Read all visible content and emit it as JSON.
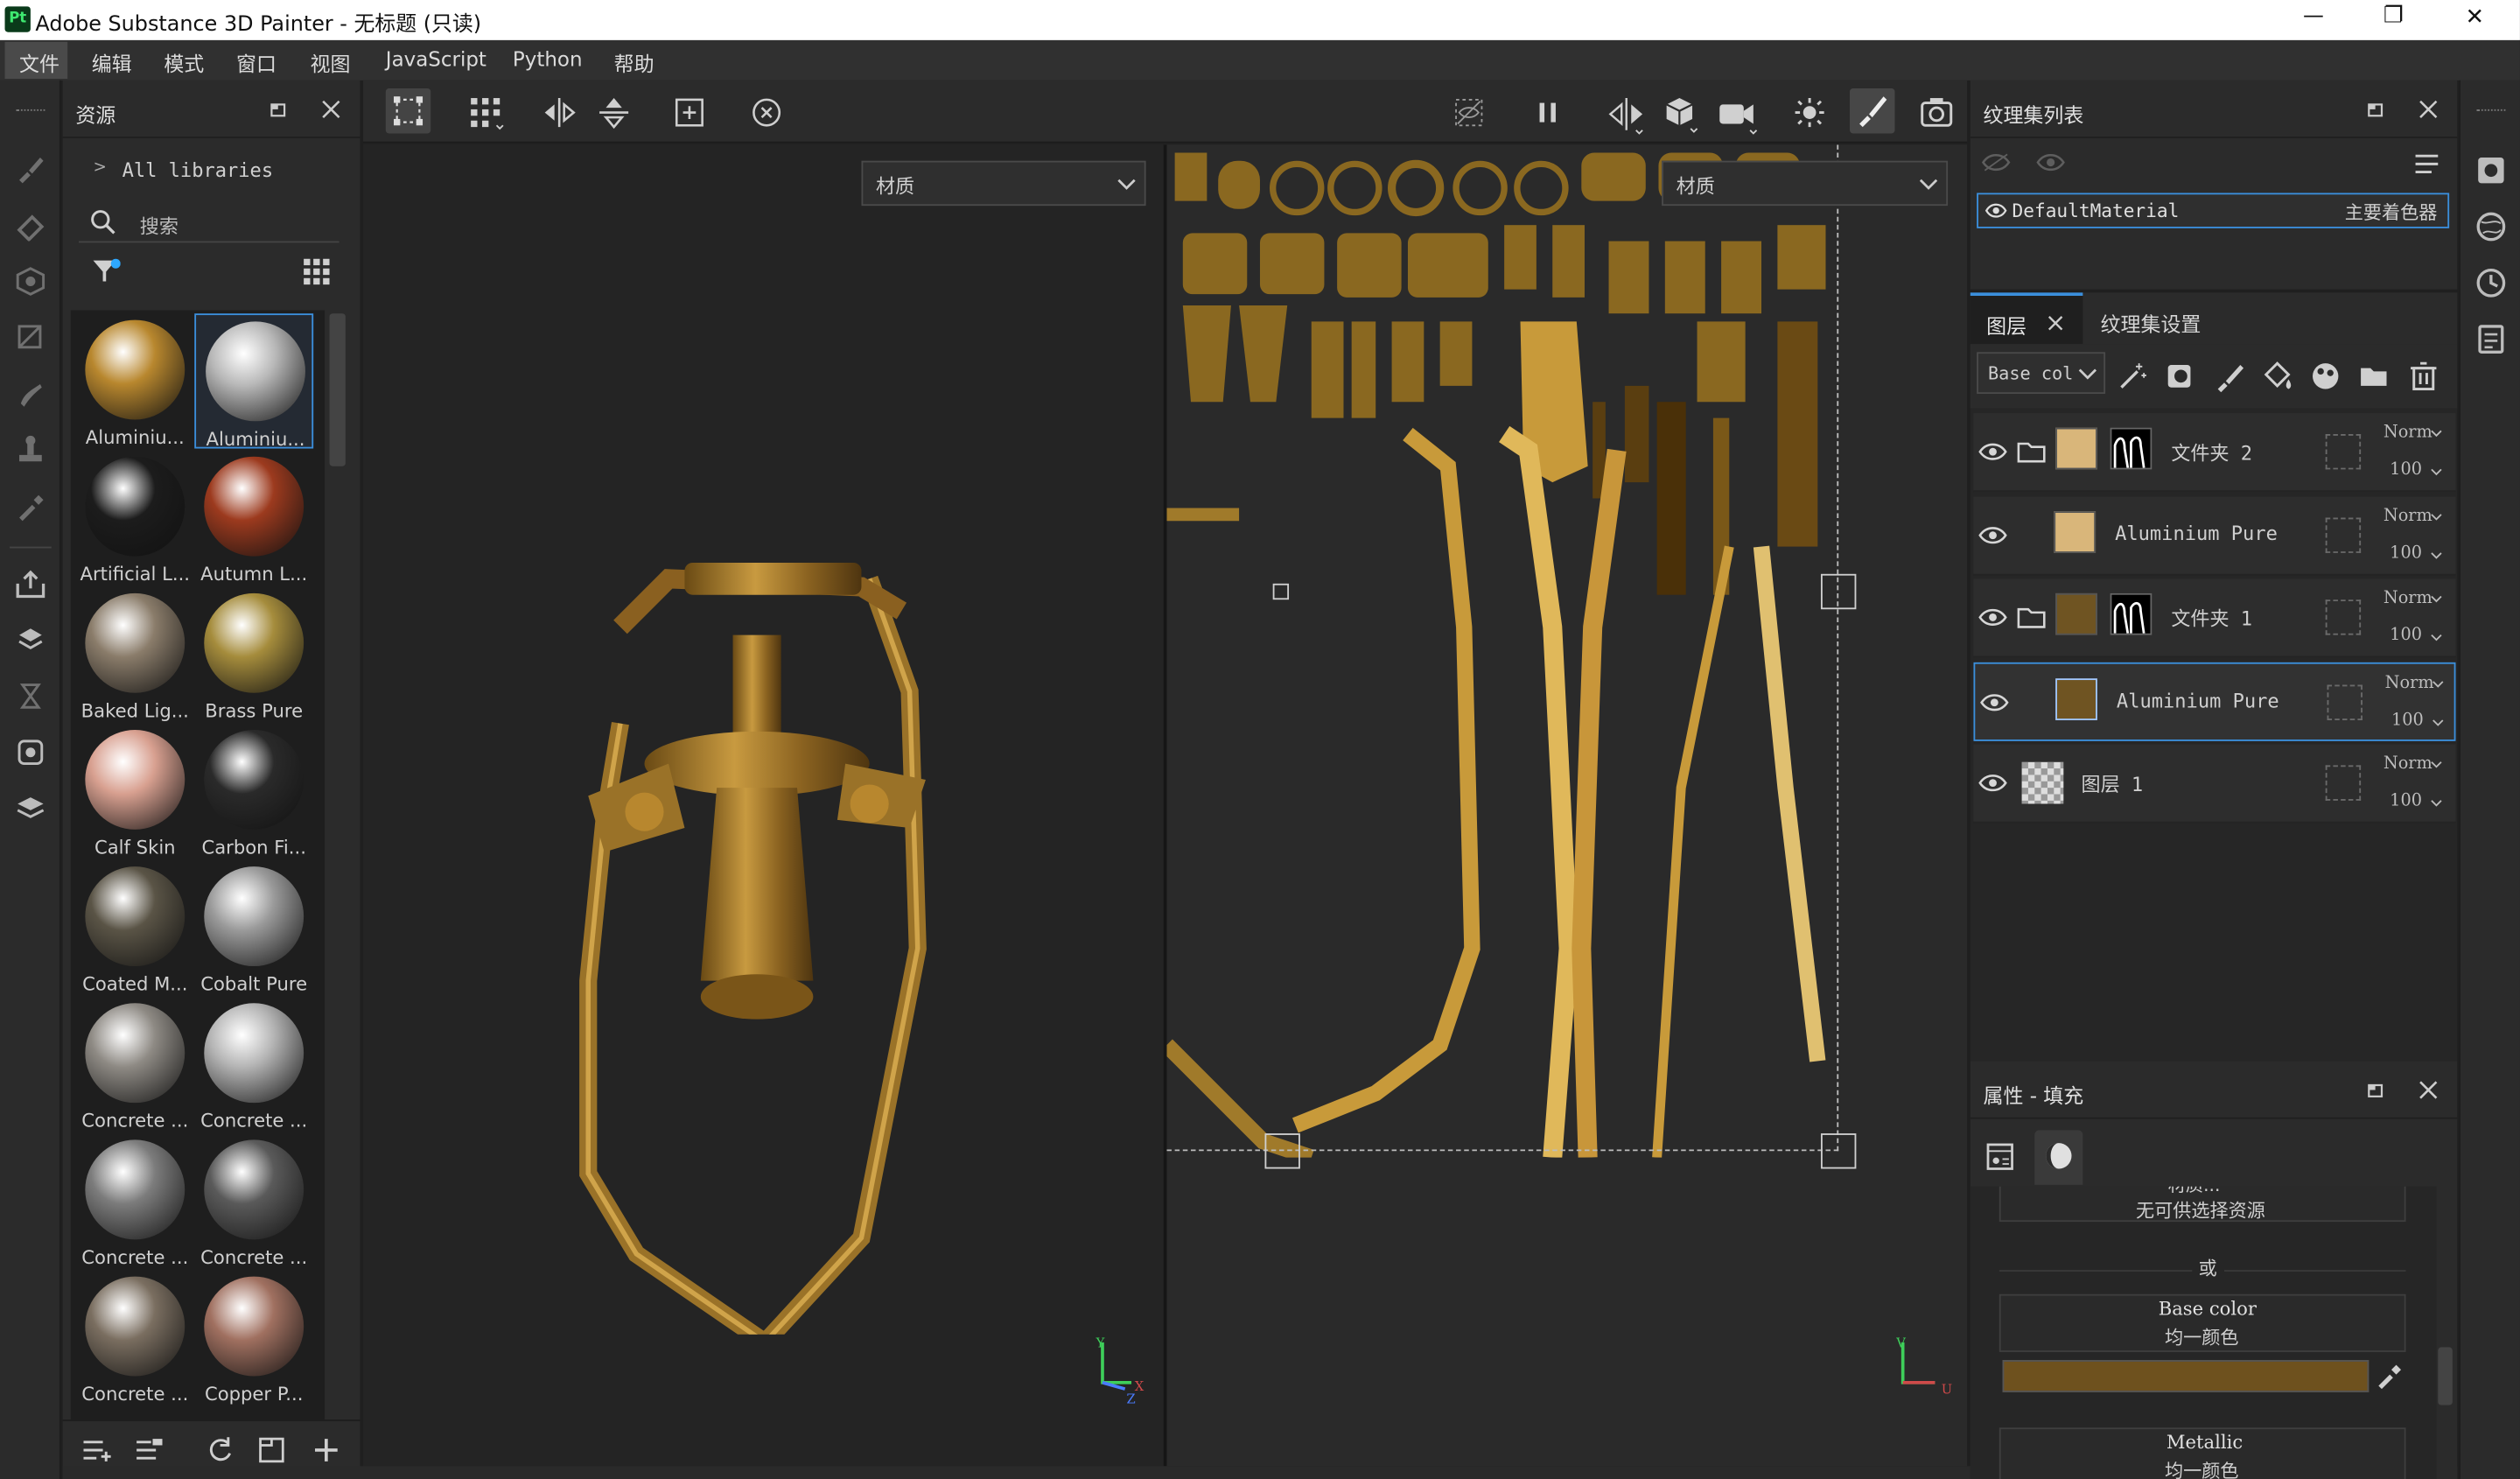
{
  "window": {
    "title": "Adobe Substance 3D Painter - 无标题 (只读)",
    "app_badge": "Pt",
    "minimize": "—",
    "restore": "❐",
    "close": "✕"
  },
  "menu": [
    "文件",
    "编辑",
    "模式",
    "窗口",
    "视图",
    "JavaScript",
    "Python",
    "帮助"
  ],
  "assets": {
    "title": "资源",
    "breadcrumb": "All libraries",
    "search_placeholder": "搜索",
    "materials": [
      {
        "label": "Aluminiu...",
        "color": "#b8872e",
        "selected": false
      },
      {
        "label": "Aluminiu...",
        "color": "#b8b8b8",
        "selected": true
      },
      {
        "label": "Artificial L...",
        "color": "#1c1c1c",
        "selected": false
      },
      {
        "label": "Autumn L...",
        "color": "#9c3a1e",
        "selected": false
      },
      {
        "label": "Baked Lig...",
        "color": "#8a7c6a",
        "selected": false
      },
      {
        "label": "Brass Pure",
        "color": "#a58c3c",
        "selected": false
      },
      {
        "label": "Calf Skin",
        "color": "#d8a090",
        "selected": false
      },
      {
        "label": "Carbon Fi...",
        "color": "#2a2a2a",
        "selected": false
      },
      {
        "label": "Coated M...",
        "color": "#5a5446",
        "selected": false
      },
      {
        "label": "Cobalt Pure",
        "color": "#9a9a9a",
        "selected": false
      },
      {
        "label": "Concrete ...",
        "color": "#8e8a84",
        "selected": false
      },
      {
        "label": "Concrete ...",
        "color": "#b4b4b4",
        "selected": false
      },
      {
        "label": "Concrete ...",
        "color": "#7c7c7c",
        "selected": false
      },
      {
        "label": "Concrete ...",
        "color": "#5a5a5a",
        "selected": false
      },
      {
        "label": "Concrete ...",
        "color": "#7a6e60",
        "selected": false
      },
      {
        "label": "Copper P...",
        "color": "#a07060",
        "selected": false
      }
    ]
  },
  "viewport": {
    "left_dropdown": "材质",
    "right_dropdown": "材质",
    "axis_left": {
      "y": "Y",
      "x": "X",
      "z": "Z"
    },
    "axis_right": {
      "v": "V",
      "u": "U"
    }
  },
  "texture_set_list": {
    "title": "纹理集列表",
    "item_name": "DefaultMaterial",
    "item_shader": "主要着色器"
  },
  "layers": {
    "tab_layers": "图层",
    "tab_settings": "纹理集设置",
    "channel_dropdown": "Base col",
    "rows": [
      {
        "name": "文件夹 2",
        "folder": true,
        "blend": "Norm",
        "opacity": "100",
        "thumb": "#d9b67a",
        "mask": true,
        "selected": false
      },
      {
        "name": "Aluminium Pure",
        "folder": false,
        "blend": "Norm",
        "opacity": "100",
        "thumb": "#d9b67a",
        "mask": false,
        "selected": false
      },
      {
        "name": "文件夹 1",
        "folder": true,
        "blend": "Norm",
        "opacity": "100",
        "thumb": "#6f5422",
        "mask": true,
        "selected": false
      },
      {
        "name": "Aluminium Pure",
        "folder": false,
        "blend": "Norm",
        "opacity": "100",
        "thumb": "#6f5422",
        "mask": false,
        "selected": true
      },
      {
        "name": "图层 1",
        "folder": false,
        "blend": "Norm",
        "opacity": "100",
        "thumb": "checker",
        "mask": false,
        "selected": false
      }
    ]
  },
  "properties": {
    "title": "属性 - 填充",
    "resource_partial": "材质...",
    "no_resource": "无可供选择资源",
    "or_label": "或",
    "base_color_title": "Base color",
    "base_color_sub": "均一颜色",
    "base_color_value": "#6e511e",
    "metallic_title": "Metallic",
    "metallic_sub": "均一颜色"
  }
}
